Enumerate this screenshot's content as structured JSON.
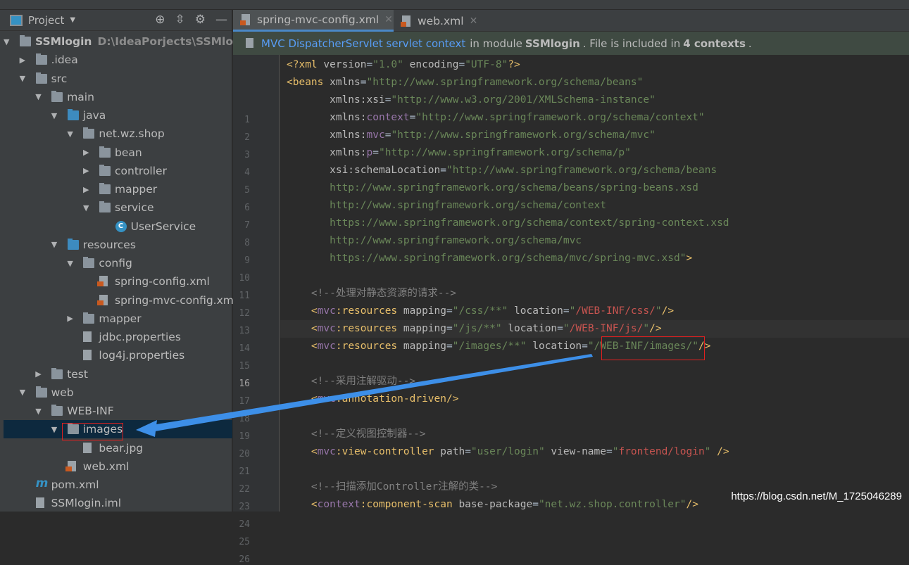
{
  "project_panel": {
    "title": "Project",
    "tree": [
      {
        "depth": 0,
        "arrow": "down",
        "icon": "module",
        "label": "SSMlogin",
        "bold": true,
        "path": "D:\\IdeaPorjects\\SSMlogin"
      },
      {
        "depth": 1,
        "arrow": "right",
        "icon": "folder",
        "label": ".idea"
      },
      {
        "depth": 1,
        "arrow": "down",
        "icon": "folder",
        "label": "src"
      },
      {
        "depth": 2,
        "arrow": "down",
        "icon": "folder",
        "label": "main"
      },
      {
        "depth": 3,
        "arrow": "down",
        "icon": "folder-blue",
        "label": "java"
      },
      {
        "depth": 4,
        "arrow": "down",
        "icon": "package",
        "label": "net.wz.shop"
      },
      {
        "depth": 5,
        "arrow": "right",
        "icon": "package",
        "label": "bean"
      },
      {
        "depth": 5,
        "arrow": "right",
        "icon": "package",
        "label": "controller"
      },
      {
        "depth": 5,
        "arrow": "right",
        "icon": "package",
        "label": "mapper"
      },
      {
        "depth": 5,
        "arrow": "down",
        "icon": "package",
        "label": "service"
      },
      {
        "depth": 6,
        "arrow": "",
        "icon": "class",
        "label": "UserService"
      },
      {
        "depth": 3,
        "arrow": "down",
        "icon": "resources",
        "label": "resources"
      },
      {
        "depth": 4,
        "arrow": "down",
        "icon": "package",
        "label": "config"
      },
      {
        "depth": 5,
        "arrow": "",
        "icon": "xml",
        "label": "spring-config.xml"
      },
      {
        "depth": 5,
        "arrow": "",
        "icon": "xml",
        "label": "spring-mvc-config.xml"
      },
      {
        "depth": 4,
        "arrow": "right",
        "icon": "package",
        "label": "mapper"
      },
      {
        "depth": 4,
        "arrow": "",
        "icon": "properties",
        "label": "jdbc.properties"
      },
      {
        "depth": 4,
        "arrow": "",
        "icon": "properties",
        "label": "log4j.properties"
      },
      {
        "depth": 2,
        "arrow": "right",
        "icon": "folder",
        "label": "test"
      },
      {
        "depth": 1,
        "arrow": "down",
        "icon": "web",
        "label": "web"
      },
      {
        "depth": 2,
        "arrow": "down",
        "icon": "folder",
        "label": "WEB-INF"
      },
      {
        "depth": 3,
        "arrow": "down",
        "icon": "folder",
        "label": "images",
        "selected": true
      },
      {
        "depth": 4,
        "arrow": "",
        "icon": "image",
        "label": "bear.jpg"
      },
      {
        "depth": 3,
        "arrow": "",
        "icon": "xml",
        "label": "web.xml"
      },
      {
        "depth": 1,
        "arrow": "",
        "icon": "maven",
        "label": "pom.xml"
      },
      {
        "depth": 1,
        "arrow": "",
        "icon": "iml",
        "label": "SSMlogin.iml"
      }
    ]
  },
  "tabs": [
    {
      "label": "spring-mvc-config.xml",
      "active": true
    },
    {
      "label": "web.xml",
      "active": false
    }
  ],
  "banner": {
    "link": "MVC DispatcherServlet servlet context",
    "text1": "in module",
    "module": "SSMlogin",
    "text2": ". File is included in",
    "contexts": "4 contexts",
    "text3": "."
  },
  "editor": {
    "current_line": 16,
    "lines": [
      [
        [
          "t",
          "<?xml "
        ],
        [
          "a",
          "version"
        ],
        [
          "p",
          "="
        ],
        [
          "v",
          "\"1.0\" "
        ],
        [
          "a",
          "encoding"
        ],
        [
          "p",
          "="
        ],
        [
          "v",
          "\"UTF-8\""
        ],
        [
          "t",
          "?>"
        ]
      ],
      [
        [
          "t",
          "<beans "
        ],
        [
          "a",
          "xmlns"
        ],
        [
          "p",
          "="
        ],
        [
          "v",
          "\"http://www.springframework.org/schema/beans\""
        ]
      ],
      [
        [
          "p",
          "       "
        ],
        [
          "a",
          "xmlns:xsi"
        ],
        [
          "p",
          "="
        ],
        [
          "v",
          "\"http://www.w3.org/2001/XMLSchema-instance\""
        ]
      ],
      [
        [
          "p",
          "       "
        ],
        [
          "a",
          "xmlns:"
        ],
        [
          "ns",
          "context"
        ],
        [
          "p",
          "="
        ],
        [
          "v",
          "\"http://www.springframework.org/schema/context\""
        ]
      ],
      [
        [
          "p",
          "       "
        ],
        [
          "a",
          "xmlns:"
        ],
        [
          "ns",
          "mvc"
        ],
        [
          "p",
          "="
        ],
        [
          "v",
          "\"http://www.springframework.org/schema/mvc\""
        ]
      ],
      [
        [
          "p",
          "       "
        ],
        [
          "a",
          "xmlns:"
        ],
        [
          "ns",
          "p"
        ],
        [
          "p",
          "="
        ],
        [
          "v",
          "\"http://www.springframework.org/schema/p\""
        ]
      ],
      [
        [
          "p",
          "       "
        ],
        [
          "a",
          "xsi:schemaLocation"
        ],
        [
          "p",
          "="
        ],
        [
          "v",
          "\"http://www.springframework.org/schema/beans"
        ]
      ],
      [
        [
          "v",
          "       http://www.springframework.org/schema/beans/spring-beans.xsd"
        ]
      ],
      [
        [
          "v",
          "       http://www.springframework.org/schema/context"
        ]
      ],
      [
        [
          "v",
          "       https://www.springframework.org/schema/context/spring-context.xsd"
        ]
      ],
      [
        [
          "v",
          "       http://www.springframework.org/schema/mvc"
        ]
      ],
      [
        [
          "v",
          "       https://www.springframework.org/schema/mvc/spring-mvc.xsd\""
        ],
        [
          "t",
          ">"
        ]
      ],
      [],
      [
        [
          "c",
          "    <!--处理对静态资源的请求-->"
        ]
      ],
      [
        [
          "t",
          "    <"
        ],
        [
          "ns",
          "mvc"
        ],
        [
          "t",
          ":resources "
        ],
        [
          "a",
          "mapping"
        ],
        [
          "p",
          "="
        ],
        [
          "v",
          "\"/css/**\" "
        ],
        [
          "a",
          "location"
        ],
        [
          "p",
          "="
        ],
        [
          "v",
          "\""
        ],
        [
          "r",
          "/WEB-INF/css/"
        ],
        [
          "v",
          "\""
        ],
        [
          "t",
          "/>"
        ]
      ],
      [
        [
          "t",
          "    <"
        ],
        [
          "ns",
          "mvc"
        ],
        [
          "t",
          ":resources "
        ],
        [
          "a",
          "mapping"
        ],
        [
          "p",
          "="
        ],
        [
          "v",
          "\"/js/**\" "
        ],
        [
          "a",
          "location"
        ],
        [
          "p",
          "="
        ],
        [
          "v",
          "\""
        ],
        [
          "r",
          "/WEB-INF/js/"
        ],
        [
          "v",
          "\""
        ],
        [
          "t",
          "/>"
        ]
      ],
      [
        [
          "t",
          "    <"
        ],
        [
          "ns",
          "mvc"
        ],
        [
          "t",
          ":resources "
        ],
        [
          "a",
          "mapping"
        ],
        [
          "p",
          "="
        ],
        [
          "v",
          "\"/images/**\" "
        ],
        [
          "a",
          "location"
        ],
        [
          "p",
          "="
        ],
        [
          "v",
          "\"/WEB-INF/images/\""
        ],
        [
          "t",
          "/>"
        ]
      ],
      [],
      [
        [
          "c",
          "    <!--采用注解驱动-->"
        ]
      ],
      [
        [
          "t",
          "    <"
        ],
        [
          "ns",
          "mvc"
        ],
        [
          "t",
          ":annotation-driven/>"
        ]
      ],
      [],
      [
        [
          "c",
          "    <!--定义视图控制器-->"
        ]
      ],
      [
        [
          "t",
          "    <"
        ],
        [
          "ns",
          "mvc"
        ],
        [
          "t",
          ":view-controller "
        ],
        [
          "a",
          "path"
        ],
        [
          "p",
          "="
        ],
        [
          "v",
          "\"user/login\" "
        ],
        [
          "a",
          "view-name"
        ],
        [
          "p",
          "="
        ],
        [
          "v",
          "\""
        ],
        [
          "r",
          "frontend/login"
        ],
        [
          "v",
          "\" "
        ],
        [
          "t",
          "/>"
        ]
      ],
      [],
      [
        [
          "c",
          "    <!--扫描添加Controller注解的类-->"
        ]
      ],
      [
        [
          "t",
          "    <"
        ],
        [
          "ns",
          "context"
        ],
        [
          "t",
          ":component-scan "
        ],
        [
          "a",
          "base-package"
        ],
        [
          "p",
          "="
        ],
        [
          "v",
          "\"net.wz.shop.controller\""
        ],
        [
          "t",
          "/>"
        ]
      ]
    ]
  },
  "watermark": "https://blog.csdn.net/M_1725046289",
  "colors": {
    "accent": "#4a88c7",
    "annotation_arrow": "#3d8fe8",
    "annotation_box": "#e02020",
    "selection": "#0d293e"
  }
}
